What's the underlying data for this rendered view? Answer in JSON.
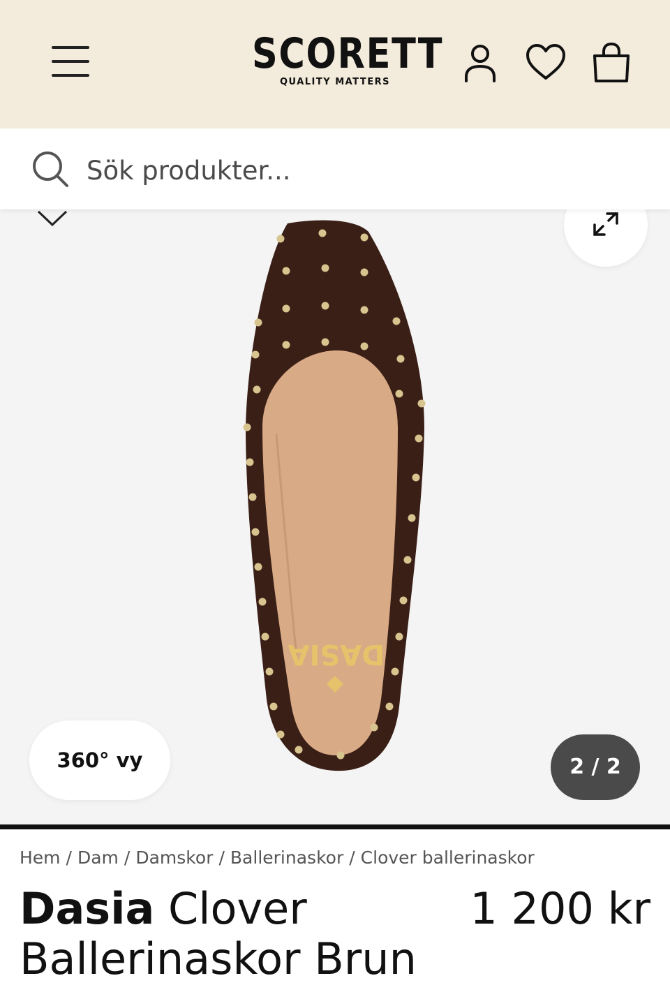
{
  "header": {
    "logo": "SCORETT",
    "tagline": "QUALITY MATTERS"
  },
  "icons": {
    "menu": "hamburger-menu-icon",
    "account": "user-icon",
    "wishlist": "heart-icon",
    "cart": "shopping-bag-icon",
    "search": "search-icon",
    "prev": "chevron-down-icon",
    "expand": "expand-arrows-icon"
  },
  "search": {
    "placeholder": "Sök produkter..."
  },
  "gallery": {
    "view360_label": "360° vy",
    "counter": "2 / 2",
    "insole_brand": "DASIA"
  },
  "breadcrumb": [
    "Hem",
    "Dam",
    "Damskor",
    "Ballerinaskor",
    "Clover ballerinaskor"
  ],
  "product": {
    "brand": "Dasia",
    "name": "Clover Ballerinaskor Brun",
    "price": "1 200 kr"
  },
  "colors": {
    "header_bg": "#f3ebdb",
    "gallery_bg": "#f4f4f4",
    "counter_bg": "#4a4a4a",
    "shoe_suede": "#3a1f17",
    "insole": "#d9aa86",
    "stud": "#d8c48e"
  }
}
